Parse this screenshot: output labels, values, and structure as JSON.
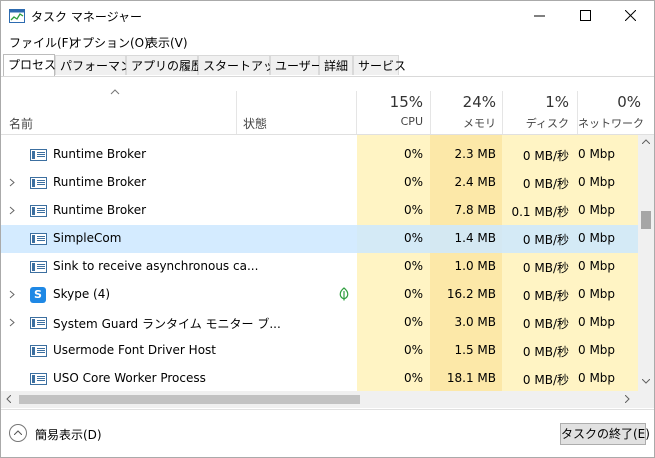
{
  "window": {
    "title": "タスク マネージャー"
  },
  "menu": [
    "ファイル(F)",
    "オプション(O)",
    "表示(V)"
  ],
  "tabs": [
    "プロセス",
    "パフォーマンス",
    "アプリの履歴",
    "スタートアップ",
    "ユーザー",
    "詳細",
    "サービス"
  ],
  "active_tab": "プロセス",
  "columns": {
    "name": "名前",
    "status": "状態",
    "cpu": {
      "percent": "15%",
      "label": "CPU"
    },
    "memory": {
      "percent": "24%",
      "label": "メモリ"
    },
    "disk": {
      "percent": "1%",
      "label": "ディスク"
    },
    "network": {
      "percent": "0%",
      "label": "ネットワーク"
    }
  },
  "rows": [
    {
      "name": "Runtime Broker",
      "expandable": false,
      "icon": "process-icon",
      "eco": false,
      "cpu": "0%",
      "memory": "2.3 MB",
      "disk": "0 MB/秒",
      "network": "0 Mbp"
    },
    {
      "name": "Runtime Broker",
      "expandable": true,
      "icon": "process-icon",
      "eco": false,
      "cpu": "0%",
      "memory": "2.4 MB",
      "disk": "0 MB/秒",
      "network": "0 Mbp"
    },
    {
      "name": "Runtime Broker",
      "expandable": true,
      "icon": "process-icon",
      "eco": false,
      "cpu": "0%",
      "memory": "7.8 MB",
      "disk": "0.1 MB/秒",
      "network": "0 Mbp"
    },
    {
      "name": "SimpleCom",
      "expandable": false,
      "icon": "process-icon",
      "eco": false,
      "selected": true,
      "cpu": "0%",
      "memory": "1.4 MB",
      "disk": "0 MB/秒",
      "network": "0 Mbp"
    },
    {
      "name": "Sink to receive asynchronous ca...",
      "expandable": false,
      "icon": "process-icon",
      "eco": false,
      "cpu": "0%",
      "memory": "1.0 MB",
      "disk": "0 MB/秒",
      "network": "0 Mbp"
    },
    {
      "name": "Skype (4)",
      "expandable": true,
      "icon": "skype-icon",
      "eco": true,
      "cpu": "0%",
      "memory": "16.2 MB",
      "disk": "0 MB/秒",
      "network": "0 Mbp"
    },
    {
      "name": "System Guard ランタイム モニター ブ...",
      "expandable": true,
      "icon": "process-icon",
      "eco": false,
      "cpu": "0%",
      "memory": "3.0 MB",
      "disk": "0 MB/秒",
      "network": "0 Mbp"
    },
    {
      "name": "Usermode Font Driver Host",
      "expandable": false,
      "icon": "process-icon",
      "eco": false,
      "cpu": "0%",
      "memory": "1.5 MB",
      "disk": "0 MB/秒",
      "network": "0 Mbp"
    },
    {
      "name": "USO Core Worker Process",
      "expandable": false,
      "icon": "process-icon",
      "eco": false,
      "cpu": "0%",
      "memory": "18.1 MB",
      "disk": "0 MB/秒",
      "network": "0 Mbp"
    }
  ],
  "footer": {
    "less_details": "簡易表示(D)",
    "end_task": "タスクの終了(E)"
  },
  "colors": {
    "cpu_band": "#fff4c4",
    "memory_band": "#fce8a8",
    "disk_band": "#fff4c4",
    "network_band": "#fff4c4",
    "selection": "#cce8ff"
  }
}
